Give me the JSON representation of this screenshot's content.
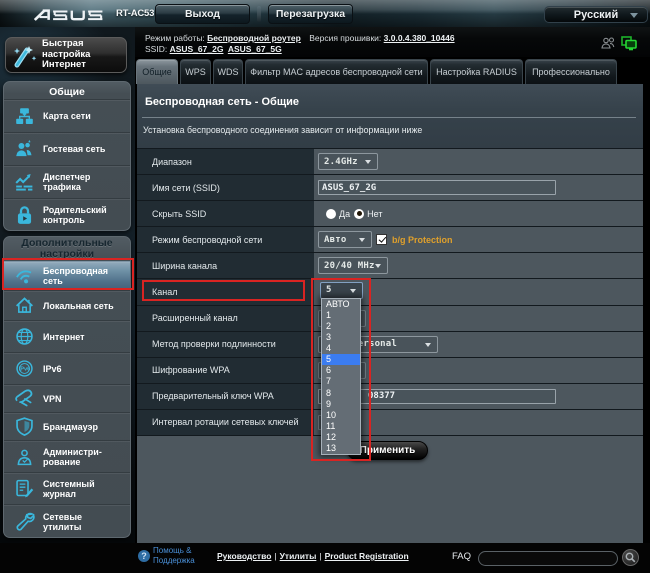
{
  "topbar": {
    "brand": "ASUS",
    "model": "RT-AC53",
    "logout_label": "Выход",
    "reboot_label": "Перезагрузка",
    "language": "Русский"
  },
  "infobar": {
    "mode_label": "Режим работы:",
    "mode_value": "Беспроводной роутер",
    "firmware_label": "Версия прошивки:",
    "firmware_value": "3.0.0.4.380_10446",
    "ssid_label": "SSID:",
    "ssid_2g": "ASUS_67_2G",
    "ssid_5g": "ASUS_67_5G",
    "icons": [
      "clients-icon",
      "wired-clients-icon"
    ]
  },
  "tabs": [
    {
      "label": "Общие",
      "active": true
    },
    {
      "label": "WPS",
      "active": false
    },
    {
      "label": "WDS",
      "active": false
    },
    {
      "label": "Фильтр MAC адресов беспроводной сети",
      "active": false
    },
    {
      "label": "Настройка RADIUS",
      "active": false
    },
    {
      "label": "Профессионально",
      "active": false
    }
  ],
  "sidebar": {
    "quick_setup": "Быстрая настройка Интернет",
    "quick_setup_lines": [
      "Быстрая",
      "настройка",
      "Интернет"
    ],
    "sections": [
      {
        "title": "Общие",
        "title_style": "light",
        "items": [
          {
            "label": "Карта сети",
            "icon": "network-map-icon"
          },
          {
            "label": "Гостевая сеть",
            "icon": "guest-network-icon"
          },
          {
            "label": "Диспетчер трафика",
            "icon": "traffic-manager-icon",
            "two_lines": [
              "Диспетчер",
              "трафика"
            ]
          },
          {
            "label": "Родительский контроль",
            "icon": "parental-control-icon",
            "two_lines": [
              "Родительский",
              "контроль"
            ]
          }
        ]
      },
      {
        "title": "Дополнительные настройки",
        "title_style": "dark",
        "title_lines": [
          "Дополнительные",
          "настройки"
        ],
        "items": [
          {
            "label": "Беспроводная сеть",
            "icon": "wireless-icon",
            "selected": true,
            "two_lines": [
              "Беспроводная",
              "сеть"
            ]
          },
          {
            "label": "Локальная сеть",
            "icon": "lan-icon"
          },
          {
            "label": "Интернет",
            "icon": "wan-icon"
          },
          {
            "label": "IPv6",
            "icon": "ipv6-icon"
          },
          {
            "label": "VPN",
            "icon": "vpn-icon"
          },
          {
            "label": "Брандмауэр",
            "icon": "firewall-icon"
          },
          {
            "label": "Администрирование",
            "icon": "administration-icon",
            "two_lines": [
              "Администри-",
              "рование"
            ]
          },
          {
            "label": "Системный журнал",
            "icon": "system-log-icon",
            "two_lines": [
              "Системный",
              "журнал"
            ]
          },
          {
            "label": "Сетевые утилиты",
            "icon": "network-tools-icon",
            "two_lines": [
              "Сетевые",
              "утилиты"
            ]
          }
        ]
      }
    ]
  },
  "content": {
    "title": "Беспроводная сеть - Общие",
    "description": "Установка беспроводного соединения зависит от информации ниже",
    "apply_label": "Применить",
    "rows": [
      {
        "label": "Диапазон",
        "control": {
          "type": "select",
          "value": "2.4GHz"
        }
      },
      {
        "label": "Имя сети (SSID)",
        "control": {
          "type": "input",
          "value": "ASUS_67_2G"
        }
      },
      {
        "label": "Скрыть SSID",
        "control": {
          "type": "radios",
          "options": [
            {
              "label": "Да",
              "selected": false
            },
            {
              "label": "Нет",
              "selected": true
            }
          ]
        }
      },
      {
        "label": "Режим беспроводной сети",
        "control": {
          "type": "select",
          "value": "Авто"
        },
        "extra": {
          "type": "checkbox",
          "checked": true,
          "label": "b/g Protection",
          "label_color": "#dfa02c"
        }
      },
      {
        "label": "Ширина канала",
        "control": {
          "type": "select",
          "value": "20/40 MHz"
        }
      },
      {
        "label": "Канал",
        "control": {
          "type": "select",
          "value": "5",
          "focused": true,
          "open": true
        }
      },
      {
        "label": "Расширенный канал",
        "control": {
          "type": "select",
          "value": ""
        }
      },
      {
        "label": "Метод проверки подлинности",
        "control": {
          "type": "select",
          "value": "WPA2-Personal"
        }
      },
      {
        "label": "Шифрование WPA",
        "control": {
          "type": "select",
          "value": ""
        }
      },
      {
        "label": "Предварительный ключ WPA",
        "control": {
          "type": "input",
          "value": "08377",
          "partially_hidden": true
        }
      },
      {
        "label": "Интервал ротации сетевых ключей",
        "control": {
          "type": "input",
          "value": ""
        }
      }
    ]
  },
  "channel_dropdown": {
    "options": [
      "АВТО",
      "1",
      "2",
      "3",
      "4",
      "5",
      "6",
      "7",
      "8",
      "9",
      "10",
      "11",
      "12",
      "13"
    ],
    "selected": "5"
  },
  "annotations": {
    "color": "#d92422",
    "rects": [
      "sidebar-wireless",
      "channel-label",
      "channel-dropdown"
    ]
  },
  "footer": {
    "help_icon": "?",
    "help_lines": [
      "Помощь &",
      "Поддержка"
    ],
    "links": [
      "Руководство",
      "Утилиты",
      "Product Registration"
    ],
    "faq_label": "FAQ",
    "faq_value": ""
  }
}
